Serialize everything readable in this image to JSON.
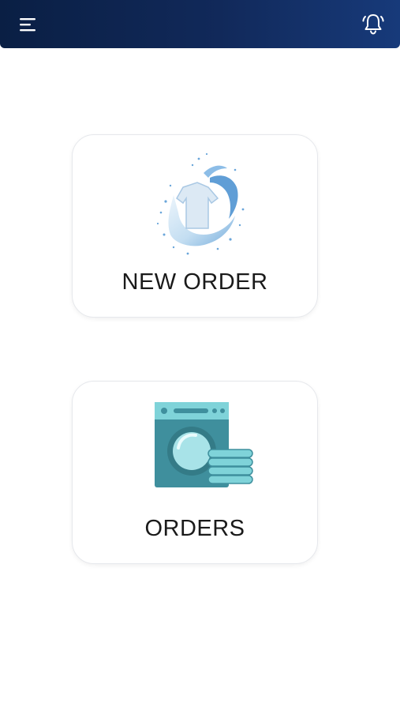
{
  "header": {
    "menu_icon": "hamburger-menu-icon",
    "notification_icon": "bell-icon"
  },
  "actions": {
    "new_order": {
      "label": "NEW ORDER",
      "icon": "water-splash-shirt-icon"
    },
    "orders": {
      "label": "ORDERS",
      "icon": "washing-machine-icon"
    }
  },
  "colors": {
    "header_dark": "#0a1f44",
    "header_light": "#173a7a",
    "accent_teal": "#3f8f9d",
    "accent_light_teal": "#7fd3d9"
  }
}
